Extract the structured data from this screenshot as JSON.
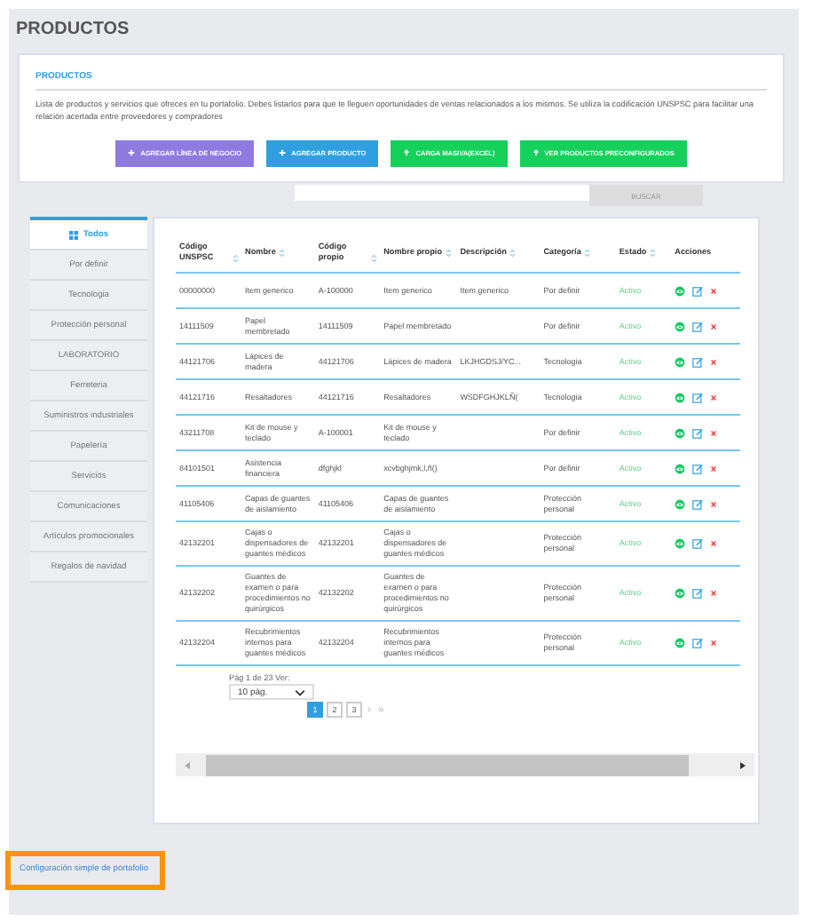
{
  "page_title": "PRODUCTOS",
  "card": {
    "title": "PRODUCTOS",
    "description": "Lista de productos y servicios que ofreces en tu portafolio. Debes listarlos para que te lleguen oportunidades de ventas relacionados a los mismos. Se utiliza la codificación UNSPSC para facilitar una relación acertada entre proveedores y compradores",
    "buttons": [
      {
        "label": "AGREGAR LÍNEA DE NEGOCIO",
        "kind": "add",
        "color": "#8e7be0"
      },
      {
        "label": "AGREGAR PRODUCTO",
        "kind": "add",
        "color": "#2f9fe0"
      },
      {
        "label": "CARGA MASIVA(EXCEL)",
        "kind": "upload",
        "color": "#16d05c"
      },
      {
        "label": "VER PRODUCTOS PRECONFIGURADOS",
        "kind": "upload",
        "color": "#16d05c"
      }
    ]
  },
  "search": {
    "button": "BUSCAR"
  },
  "sidebar": {
    "items": [
      {
        "label": "Todos",
        "selected": true
      },
      {
        "label": "Por definir",
        "selected": false
      },
      {
        "label": "Tecnologia",
        "selected": false
      },
      {
        "label": "Protección personal",
        "selected": false
      },
      {
        "label": "LABORATORIO",
        "selected": false
      },
      {
        "label": "Ferreteria",
        "selected": false
      },
      {
        "label": "Suministros industriales",
        "selected": false
      },
      {
        "label": "Papelería",
        "selected": false
      },
      {
        "label": "Servicios",
        "selected": false
      },
      {
        "label": "Comunicaciones",
        "selected": false
      },
      {
        "label": "Artículos promocionales",
        "selected": false
      },
      {
        "label": "Regalos de navidad",
        "selected": false
      }
    ]
  },
  "table": {
    "columns": [
      {
        "label": "Código UNSPSC",
        "sortable": true
      },
      {
        "label": "Nombre",
        "sortable": true
      },
      {
        "label": "Código propio",
        "sortable": true
      },
      {
        "label": "Nombre propio",
        "sortable": true
      },
      {
        "label": "Descripción",
        "sortable": true
      },
      {
        "label": "Categoría",
        "sortable": true
      },
      {
        "label": "Estado",
        "sortable": true
      },
      {
        "label": "Acciones",
        "sortable": false
      }
    ],
    "rows": [
      {
        "cells": [
          "00000000",
          "Item generico",
          "A-100000",
          "Item generico",
          "Item generico",
          "Por definir",
          "Activo"
        ]
      },
      {
        "cells": [
          "14111509",
          "Papel membretado",
          "14111509",
          "Papel membretado",
          "",
          "Por definir",
          "Activo"
        ]
      },
      {
        "cells": [
          "44121706",
          "Lápices de madera",
          "44121706",
          "Lápices de madera",
          "LKJHGDSJ/YC...",
          "Tecnologia",
          "Activo"
        ]
      },
      {
        "cells": [
          "44121716",
          "Resaltadores",
          "44121716",
          "Resaltadores",
          "WSDFGHJKLÑ(",
          "Tecnologia",
          "Activo"
        ]
      },
      {
        "cells": [
          "43211708",
          "Kit de mouse y teclado",
          "A-100001",
          "Kit de mouse y teclado",
          "",
          "Por definir",
          "Activo"
        ]
      },
      {
        "cells": [
          "84101501",
          "Asistencia financiera",
          "dfghjkl",
          "xcvbghjmk,l,ñ()",
          "",
          "Por definir",
          "Activo"
        ]
      },
      {
        "cells": [
          "41105406",
          "Capas de guantes de aislamiento",
          "41105406",
          "Capas de guantes de aislamiento",
          "",
          "Protección personal",
          "Activo"
        ]
      },
      {
        "cells": [
          "42132201",
          "Cajas o dispensadores de guantes médicos",
          "42132201",
          "Cajas o dispensadores de guantes médicos",
          "",
          "Protección personal",
          "Activo"
        ]
      },
      {
        "cells": [
          "42132202",
          "Guantes de examen o para procedimientos no quirúrgicos",
          "42132202",
          "Guantes de examen o para procedimientos no quirúrgicos",
          "",
          "Protección personal",
          "Activo"
        ]
      },
      {
        "cells": [
          "42132204",
          "Recubrimientos internos para guantes médicos",
          "42132204",
          "Recubrimientos internos para guantes médicos",
          "",
          "Protección personal",
          "Activo"
        ]
      }
    ]
  },
  "pagination": {
    "summary": "Pág 1 de 23 Ver:",
    "page_size": "10 pág.",
    "pages": [
      {
        "label": "1",
        "selected": true
      },
      {
        "label": "2",
        "selected": false
      },
      {
        "label": "3",
        "selected": false
      }
    ],
    "next": "›",
    "last": "»"
  },
  "footer_link": "Configuración simple de portafolio"
}
